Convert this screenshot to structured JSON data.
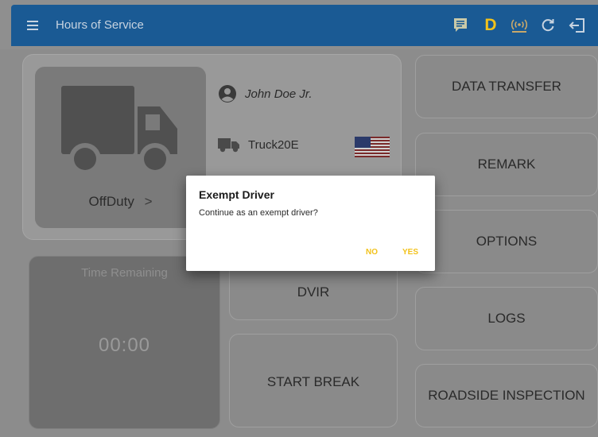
{
  "appbar": {
    "title": "Hours of Service",
    "icons": [
      "menu-icon",
      "message-icon",
      "driver-status-d-icon",
      "eld-connection-icon",
      "refresh-icon",
      "logout-icon"
    ],
    "status_letter": "D",
    "accent_color": "#f2c21b",
    "bar_color": "#1a5a94"
  },
  "status_card": {
    "status_label": "OffDuty",
    "chevron": ">"
  },
  "driver": {
    "name": "John Doe Jr."
  },
  "vehicle": {
    "truck_id": "Truck20E"
  },
  "time_card": {
    "label": "Time Remaining",
    "value": "00:00"
  },
  "middle_buttons": {
    "dvir": "DVIR",
    "start_break": "START BREAK"
  },
  "right_buttons": {
    "data_transfer": "DATA TRANSFER",
    "remark": "REMARK",
    "options": "OPTIONS",
    "logs": "LOGS",
    "roadside_inspection": "ROADSIDE INSPECTION"
  },
  "dialog": {
    "title": "Exempt Driver",
    "message": "Continue as an exempt driver?",
    "no_label": "NO",
    "yes_label": "YES"
  }
}
